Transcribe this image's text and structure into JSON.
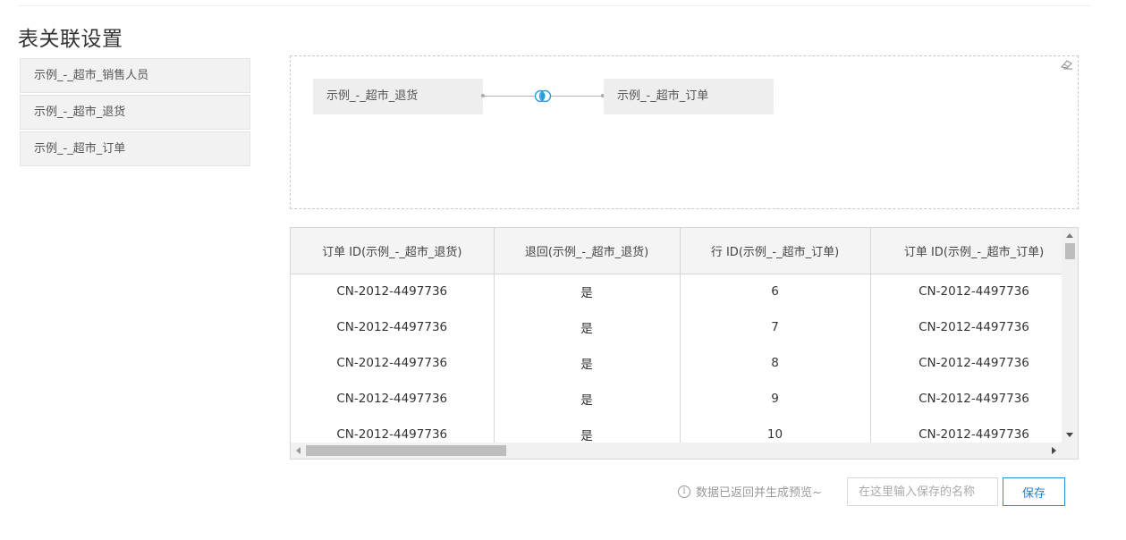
{
  "page": {
    "title": "表关联设置"
  },
  "tables": [
    {
      "label": "示例_-_超市_销售人员"
    },
    {
      "label": "示例_-_超市_退货"
    },
    {
      "label": "示例_-_超市_订单"
    }
  ],
  "canvas": {
    "left_node": "示例_-_超市_退货",
    "right_node": "示例_-_超市_订单",
    "join_icon": "inner-join-icon",
    "clear_icon": "eraser-icon"
  },
  "preview": {
    "columns": [
      "订单 ID(示例_-_超市_退货)",
      "退回(示例_-_超市_退货)",
      "行 ID(示例_-_超市_订单)",
      "订单 ID(示例_-_超市_订单)"
    ],
    "rows": [
      [
        "CN-2012-4497736",
        "是",
        "6",
        "CN-2012-4497736"
      ],
      [
        "CN-2012-4497736",
        "是",
        "7",
        "CN-2012-4497736"
      ],
      [
        "CN-2012-4497736",
        "是",
        "8",
        "CN-2012-4497736"
      ],
      [
        "CN-2012-4497736",
        "是",
        "9",
        "CN-2012-4497736"
      ],
      [
        "CN-2012-4497736",
        "是",
        "10",
        "CN-2012-4497736"
      ]
    ]
  },
  "footer": {
    "hint": "数据已返回并生成预览~",
    "hint_icon": "info-icon",
    "name_placeholder": "在这里输入保存的名称",
    "name_value": "",
    "save_label": "保存"
  },
  "colors": {
    "accent": "#1e7fcf",
    "join_icon": "#2b9be0"
  }
}
